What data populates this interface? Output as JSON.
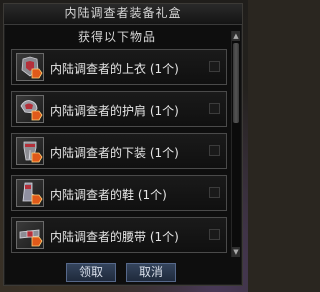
{
  "window": {
    "title": "内陆调查者装备礼盒",
    "subtitle": "获得以下物品"
  },
  "items": [
    {
      "label": "内陆调查者的上衣 (1个)",
      "icon": "chest-armor-icon"
    },
    {
      "label": "内陆调查者的护肩 (1个)",
      "icon": "shoulder-armor-icon"
    },
    {
      "label": "内陆调查者的下装 (1个)",
      "icon": "leg-armor-icon"
    },
    {
      "label": "内陆调查者的鞋 (1个)",
      "icon": "boots-icon"
    },
    {
      "label": "内陆调查者的腰带 (1个)",
      "icon": "belt-icon"
    }
  ],
  "buttons": {
    "receive": "领取",
    "cancel": "取消"
  },
  "colors": {
    "window_bg": "#0e0e0e",
    "text": "#e6e6e6",
    "button_bg": "#2a3750",
    "badge_accent": "#e05a1a"
  }
}
